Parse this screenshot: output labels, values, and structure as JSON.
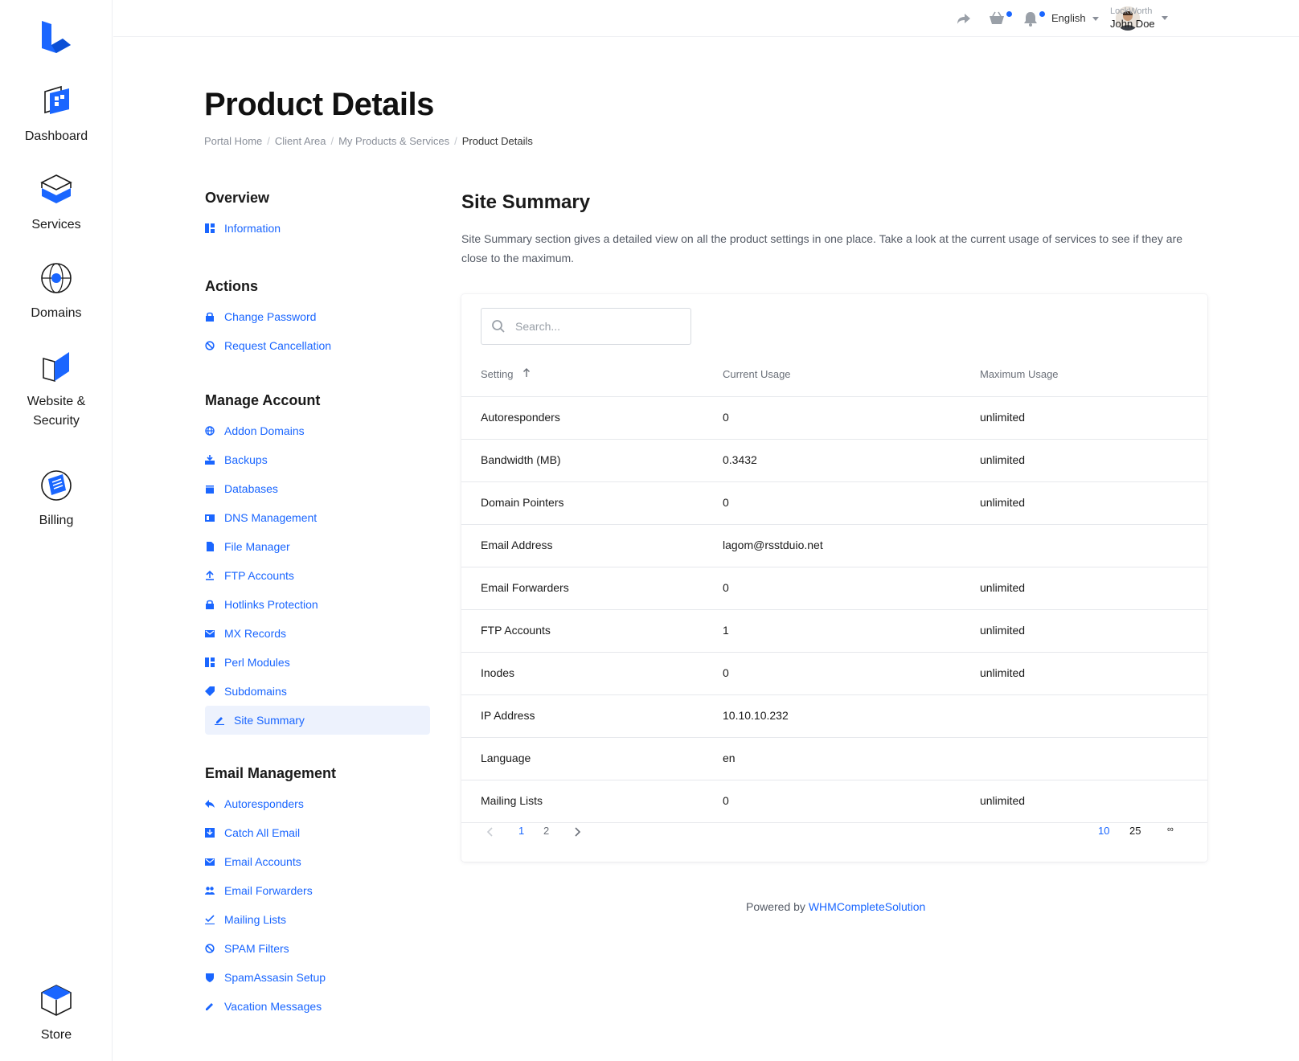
{
  "rail": {
    "items": [
      {
        "label": "Dashboard"
      },
      {
        "label": "Services"
      },
      {
        "label": "Domains"
      },
      {
        "label": "Website &"
      },
      {
        "label": "Security"
      },
      {
        "label": "Billing"
      },
      {
        "label": "Store"
      }
    ]
  },
  "topbar": {
    "language": "English",
    "user_company": "LockWorth",
    "user_name": "John Doe"
  },
  "page": {
    "title": "Product Details",
    "breadcrumb": [
      "Portal Home",
      "Client Area",
      "My Products & Services",
      "Product Details"
    ]
  },
  "sidemenu": {
    "overview_heading": "Overview",
    "overview_items": [
      "Information"
    ],
    "actions_heading": "Actions",
    "actions_items": [
      "Change Password",
      "Request Cancellation"
    ],
    "manage_heading": "Manage Account",
    "manage_items": [
      "Addon Domains",
      "Backups",
      "Databases",
      "DNS Management",
      "File Manager",
      "FTP Accounts",
      "Hotlinks Protection",
      "MX Records",
      "Perl Modules",
      "Subdomains",
      "Site Summary"
    ],
    "email_heading": "Email Management",
    "email_items": [
      "Autoresponders",
      "Catch All Email",
      "Email Accounts",
      "Email Forwarders",
      "Mailing Lists",
      "SPAM Filters",
      "SpamAssasin Setup",
      "Vacation Messages"
    ]
  },
  "section": {
    "title": "Site Summary",
    "description": "Site Summary section gives a detailed view on all the product settings in one place. Take a look at the current usage of services to see if they are close to the maximum."
  },
  "table": {
    "search_placeholder": "Search...",
    "headers": [
      "Setting",
      "Current Usage",
      "Maximum Usage"
    ],
    "rows": [
      [
        "Autoresponders",
        "0",
        "unlimited"
      ],
      [
        "Bandwidth (MB)",
        "0.3432",
        "unlimited"
      ],
      [
        "Domain Pointers",
        "0",
        "unlimited"
      ],
      [
        "Email Address",
        "lagom@rsstduio.net",
        ""
      ],
      [
        "Email Forwarders",
        "0",
        "unlimited"
      ],
      [
        "FTP Accounts",
        "1",
        "unlimited"
      ],
      [
        "Inodes",
        "0",
        "unlimited"
      ],
      [
        "IP Address",
        "10.10.10.232",
        ""
      ],
      [
        "Language",
        "en",
        ""
      ],
      [
        "Mailing Lists",
        "0",
        "unlimited"
      ]
    ],
    "pages": [
      "1",
      "2"
    ],
    "page_sizes": [
      "10",
      "25",
      "∞"
    ]
  },
  "footer": {
    "powered_by": "Powered by",
    "link": "WHMCompleteSolution"
  },
  "colors": {
    "accent": "#1a66ff",
    "text": "#1a1a1a",
    "muted": "#8a8f99"
  }
}
